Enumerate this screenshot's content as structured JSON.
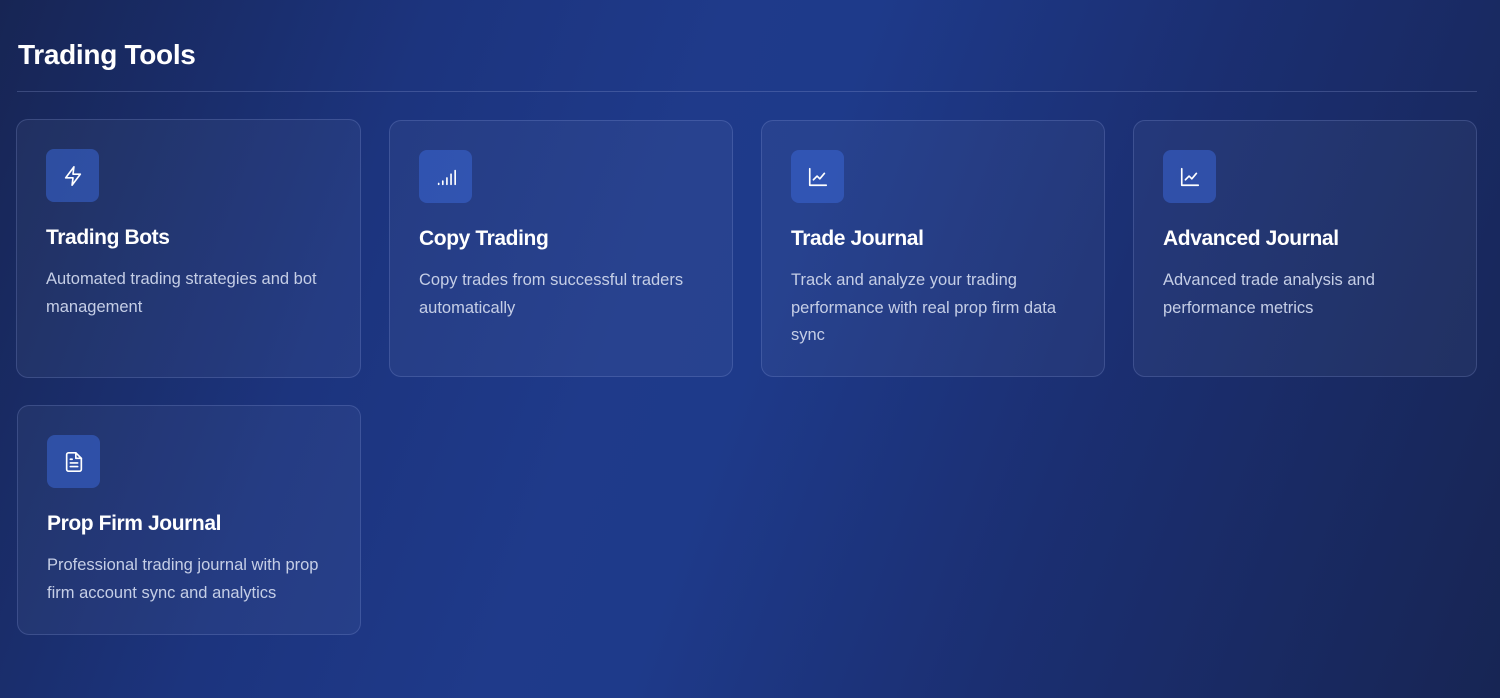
{
  "page": {
    "title": "Trading Tools"
  },
  "tools": [
    {
      "icon": "lightning-bolt-icon",
      "title": "Trading Bots",
      "description": "Automated trading strategies and bot management"
    },
    {
      "icon": "signal-bars-icon",
      "title": "Copy Trading",
      "description": "Copy trades from successful traders automatically"
    },
    {
      "icon": "line-chart-icon",
      "title": "Trade Journal",
      "description": "Track and analyze your trading performance with real prop firm data sync"
    },
    {
      "icon": "line-chart-icon",
      "title": "Advanced Journal",
      "description": "Advanced trade analysis and performance metrics"
    },
    {
      "icon": "document-icon",
      "title": "Prop Firm Journal",
      "description": "Professional trading journal with prop firm account sync and analytics"
    }
  ],
  "colors": {
    "background_start": "#172554",
    "background_mid": "#1e3a8a",
    "card_border": "#3b4f8f",
    "icon_tile": "#3b66d4",
    "title_text": "#ffffff",
    "description_text": "#c5cee6"
  }
}
